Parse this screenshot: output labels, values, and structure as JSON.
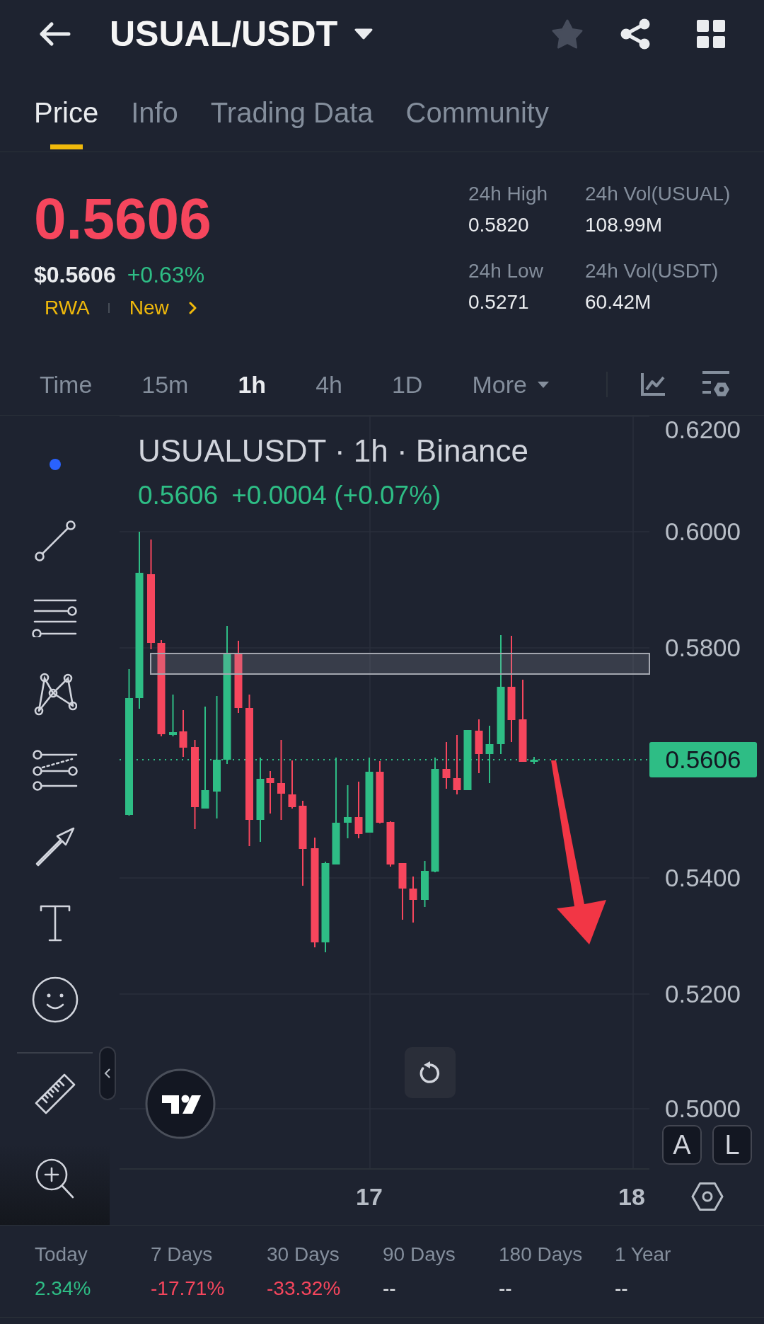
{
  "header": {
    "title": "USUAL/USDT",
    "favorite": false
  },
  "tabs": [
    {
      "label": "Price",
      "selected": true
    },
    {
      "label": "Info",
      "selected": false
    },
    {
      "label": "Trading Data",
      "selected": false
    },
    {
      "label": "Community",
      "selected": false
    }
  ],
  "ticker": {
    "price": "0.5606",
    "usd_price": "$0.5606",
    "change": "+0.63%",
    "tags": [
      "RWA",
      "New"
    ],
    "stats": [
      {
        "label": "24h High",
        "value": "0.5820"
      },
      {
        "label": "24h Vol(USUAL)",
        "value": "108.99M"
      },
      {
        "label": "24h Low",
        "value": "0.5271"
      },
      {
        "label": "24h Vol(USDT)",
        "value": "60.42M"
      }
    ]
  },
  "intervals": [
    {
      "label": "Time",
      "kind": "interval",
      "selected": false
    },
    {
      "label": "15m",
      "kind": "interval",
      "selected": false
    },
    {
      "label": "1h",
      "kind": "interval",
      "selected": true
    },
    {
      "label": "4h",
      "kind": "interval",
      "selected": false
    },
    {
      "label": "1D",
      "kind": "interval",
      "selected": false
    },
    {
      "label": "More",
      "kind": "menu",
      "selected": false
    }
  ],
  "chart": {
    "title": "USUALUSDT · 1h · Binance",
    "last": "0.5606",
    "change": "+0.0004 (+0.07%)",
    "price_axis": [
      "0.6200",
      "0.6000",
      "0.5800",
      "0.5400",
      "0.5200",
      "0.5000"
    ],
    "current_price": "0.5606",
    "time_axis": [
      "17",
      "18"
    ],
    "scale_buttons": [
      "A",
      "L"
    ]
  },
  "performance": [
    {
      "label": "Today",
      "value": "2.34%",
      "color": "#2ebd85"
    },
    {
      "label": "7 Days",
      "value": "-17.71%",
      "color": "#f6465d"
    },
    {
      "label": "30 Days",
      "value": "-33.32%",
      "color": "#f6465d"
    },
    {
      "label": "90 Days",
      "value": "--",
      "color": "#eaecef"
    },
    {
      "label": "180 Days",
      "value": "--",
      "color": "#eaecef"
    },
    {
      "label": "1 Year",
      "value": "--",
      "color": "#eaecef"
    }
  ]
}
